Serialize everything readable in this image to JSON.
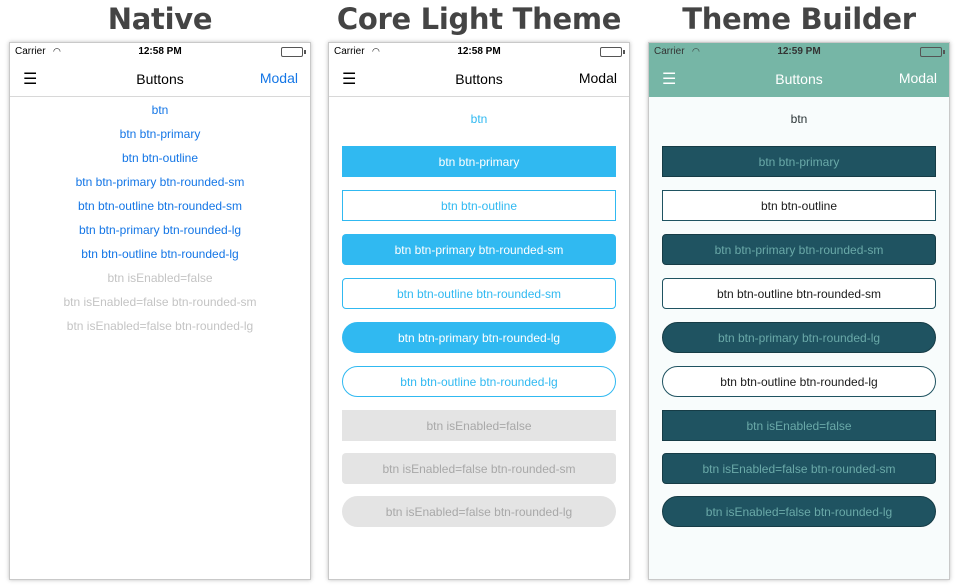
{
  "columns": {
    "native": {
      "heading": "Native",
      "status": {
        "carrier": "Carrier",
        "time": "12:58 PM"
      },
      "nav": {
        "title": "Buttons",
        "action": "Modal"
      },
      "buttons": [
        "btn",
        "btn btn-primary",
        "btn btn-outline",
        "btn btn-primary btn-rounded-sm",
        "btn btn-outline btn-rounded-sm",
        "btn btn-primary btn-rounded-lg",
        "btn btn-outline btn-rounded-lg",
        "btn isEnabled=false",
        "btn isEnabled=false btn-rounded-sm",
        "btn isEnabled=false btn-rounded-lg"
      ]
    },
    "core": {
      "heading": "Core Light Theme",
      "status": {
        "carrier": "Carrier",
        "time": "12:58 PM"
      },
      "nav": {
        "title": "Buttons",
        "action": "Modal"
      },
      "buttons": [
        "btn",
        "btn btn-primary",
        "btn btn-outline",
        "btn btn-primary btn-rounded-sm",
        "btn btn-outline btn-rounded-sm",
        "btn btn-primary btn-rounded-lg",
        "btn btn-outline btn-rounded-lg",
        "btn isEnabled=false",
        "btn isEnabled=false btn-rounded-sm",
        "btn isEnabled=false btn-rounded-lg"
      ]
    },
    "builder": {
      "heading": "Theme Builder",
      "status": {
        "carrier": "Carrier",
        "time": "12:59 PM"
      },
      "nav": {
        "title": "Buttons",
        "action": "Modal"
      },
      "buttons": [
        "btn",
        "btn btn-primary",
        "btn btn-outline",
        "btn btn-primary btn-rounded-sm",
        "btn btn-outline btn-rounded-sm",
        "btn btn-primary btn-rounded-lg",
        "btn btn-outline btn-rounded-lg",
        "btn isEnabled=false",
        "btn isEnabled=false btn-rounded-sm",
        "btn isEnabled=false btn-rounded-lg"
      ]
    }
  },
  "icons": {
    "menu": "hamburger-menu-icon",
    "wifi": "wifi-icon",
    "battery": "battery-icon"
  },
  "colors": {
    "native_link": "#1476e6",
    "core_accent": "#30b9f1",
    "builder_nav": "#76b6a6",
    "builder_button": "#1f5361"
  }
}
